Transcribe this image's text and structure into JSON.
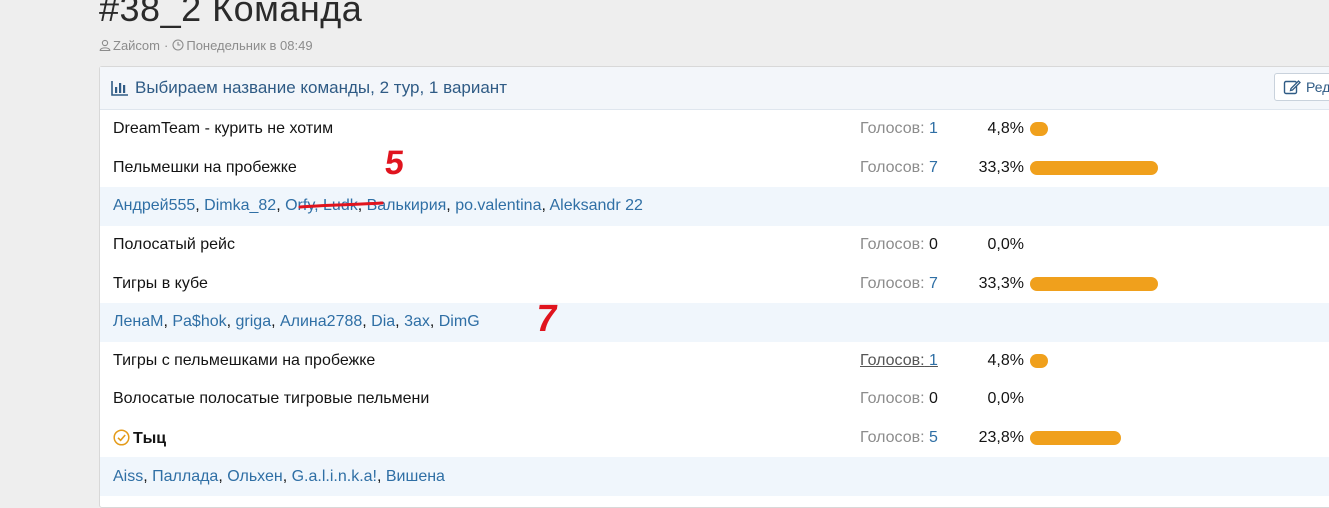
{
  "thread": {
    "title": "#38_2 Команда",
    "author": "Zaйcom",
    "date": "Понедельник в 08:49"
  },
  "poll": {
    "title": "Выбираем название команды, 2 тур, 1 вариант",
    "edit_label": "Ред",
    "votes_label": "Голосов:",
    "options": [
      {
        "label": "DreamTeam - курить не хотим",
        "votes": "1",
        "percent": "4,8%",
        "fraction": 0.048
      },
      {
        "label": "Пельмешки на пробежке",
        "votes": "7",
        "percent": "33,3%",
        "fraction": 0.333
      },
      {
        "label": "Полосатый рейс",
        "votes": "0",
        "percent": "0,0%",
        "fraction": 0
      },
      {
        "label": "Тигры в кубе",
        "votes": "7",
        "percent": "33,3%",
        "fraction": 0.333
      },
      {
        "label": "Тигры с пельмешками на пробежке",
        "votes": "1",
        "percent": "4,8%",
        "fraction": 0.048
      },
      {
        "label": "Волосатые полосатые тигровые пельмени",
        "votes": "0",
        "percent": "0,0%",
        "fraction": 0
      },
      {
        "label": "Тыц",
        "votes": "5",
        "percent": "23,8%",
        "fraction": 0.238
      }
    ],
    "voters_pelmeshki": [
      "Андрей555",
      "Dimka_82",
      "Orfy, Ludk",
      "Валькирия",
      "po.valentina",
      "Aleksandr 22"
    ],
    "voters_tigry": [
      "ЛенаМ",
      "Pa$hok",
      "griga",
      "Алина2788",
      "Dia",
      "3ax",
      "DimG"
    ],
    "voters_tyc": [
      "Aiss",
      "Паллада",
      "Ольхен",
      "G.a.l.i.n.k.a!",
      "Вишена"
    ]
  },
  "annotations": {
    "mark_5": "5",
    "mark_7": "7",
    "color": "#e0141e"
  },
  "colors": {
    "bar": "#f0a01c",
    "link": "#2f6fa5",
    "header_bg": "#f3f6fa",
    "voters_bg": "#f0f6fc"
  }
}
